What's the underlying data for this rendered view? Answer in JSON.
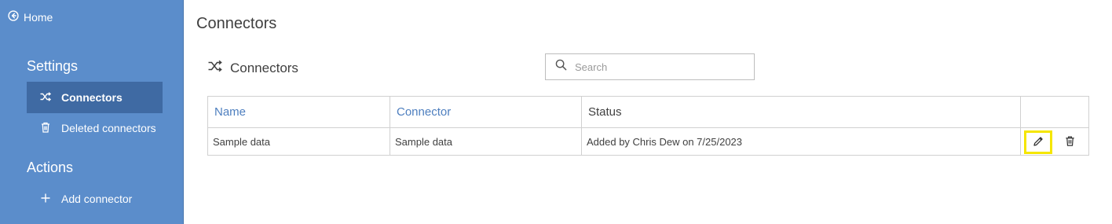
{
  "sidebar": {
    "home_label": "Home",
    "home_icon": "back-arrow-circle-icon",
    "settings_title": "Settings",
    "items": [
      {
        "label": "Connectors",
        "icon": "shuffle-icon",
        "active": true
      },
      {
        "label": "Deleted connectors",
        "icon": "trash-icon",
        "active": false
      }
    ],
    "actions_title": "Actions",
    "actions": [
      {
        "label": "Add connector",
        "icon": "plus-icon"
      }
    ],
    "colors": {
      "background": "#5b8dcb",
      "active": "#3f6aa3"
    }
  },
  "main": {
    "page_title": "Connectors",
    "section_title": "Connectors",
    "section_icon": "shuffle-icon",
    "search": {
      "placeholder": "Search",
      "value": "",
      "icon": "search-icon"
    },
    "table": {
      "columns": [
        "Name",
        "Connector",
        "Status"
      ],
      "rows": [
        {
          "name": "Sample data",
          "connector": "Sample data",
          "status": "Added by Chris Dew on 7/25/2023",
          "actions": [
            "pencil-icon",
            "trash-icon"
          ]
        }
      ]
    },
    "colors": {
      "link": "#4e7fbf",
      "highlight": "#f5e600"
    }
  }
}
